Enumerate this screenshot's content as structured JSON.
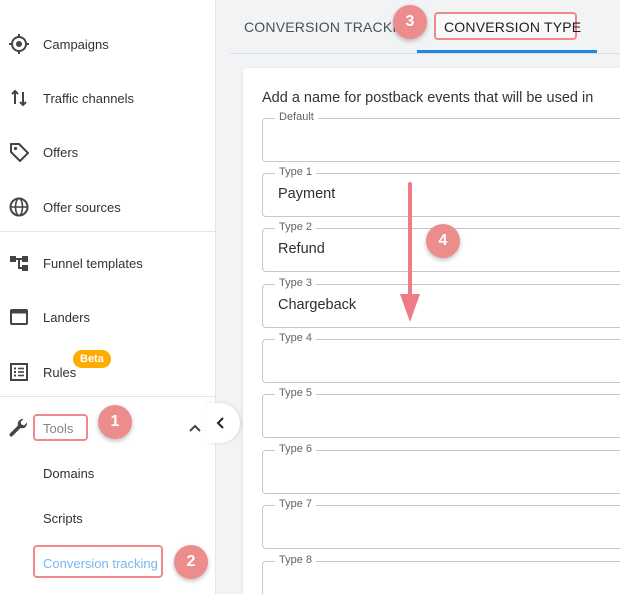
{
  "sidebar": {
    "items": [
      {
        "label": "Campaigns",
        "icon": "target-icon"
      },
      {
        "label": "Traffic channels",
        "icon": "arrows-updown-icon"
      },
      {
        "label": "Offers",
        "icon": "tag-icon"
      },
      {
        "label": "Offer sources",
        "icon": "globe-icon"
      },
      {
        "label": "Funnel templates",
        "icon": "flow-icon"
      },
      {
        "label": "Landers",
        "icon": "window-icon"
      },
      {
        "label": "Rules",
        "icon": "list-icon"
      },
      {
        "label": "Tools",
        "icon": "wrench-icon"
      }
    ],
    "beta_label": "Beta",
    "tools_sub": [
      "Domains",
      "Scripts",
      "Conversion tracking"
    ]
  },
  "tabs": [
    "CONVERSION TRACKING",
    "CONVERSION TYPE"
  ],
  "intro_text": "Add a name for postback events that will be used in",
  "fields": [
    {
      "label": "Default",
      "value": ""
    },
    {
      "label": "Type 1",
      "value": "Payment"
    },
    {
      "label": "Type 2",
      "value": "Refund"
    },
    {
      "label": "Type 3",
      "value": "Chargeback"
    },
    {
      "label": "Type 4",
      "value": ""
    },
    {
      "label": "Type 5",
      "value": ""
    },
    {
      "label": "Type 6",
      "value": ""
    },
    {
      "label": "Type 7",
      "value": ""
    },
    {
      "label": "Type 8",
      "value": ""
    }
  ],
  "annotations": [
    "1",
    "2",
    "3",
    "4"
  ],
  "colors": {
    "accent": "#1e88e5",
    "annotation": "#ec8c8c",
    "beta": "#ffab00"
  }
}
